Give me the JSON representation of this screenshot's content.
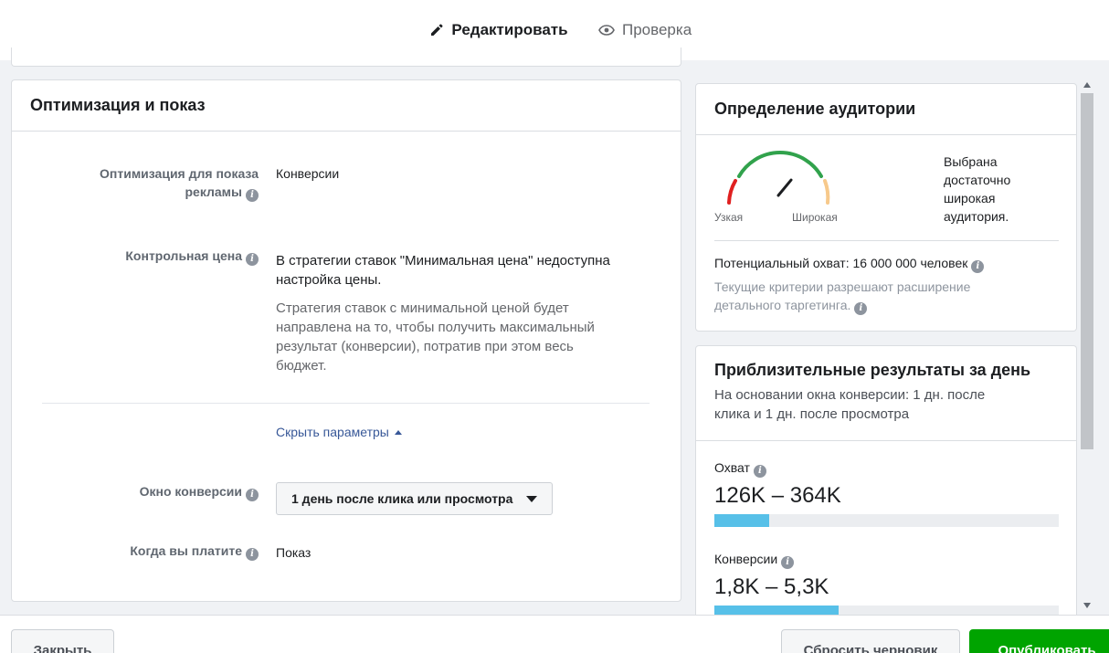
{
  "tabs": {
    "edit_label": "Редактировать",
    "review_label": "Проверка"
  },
  "optimization": {
    "title": "Оптимизация и показ",
    "ad_optimization_label_1": "Оптимизация для показа",
    "ad_optimization_label_2": "рекламы",
    "ad_optimization_value": "Конверсии",
    "control_price_label": "Контрольная цена",
    "control_price_line_1": "В стратегии ставок \"Минимальная цена\" недоступна",
    "control_price_line_2": "настройка цены.",
    "strategy_line_1": "Стратегия ставок с минимальной ценой будет",
    "strategy_line_2": "направлена на то, чтобы получить максимальный",
    "strategy_line_3": "результат (конверсии), потратив при этом весь",
    "strategy_line_4": "бюджет.",
    "hide_params_link": "Скрыть параметры",
    "conversion_window_label": "Окно конверсии",
    "conversion_window_value": "1 день после клика или просмотра",
    "when_you_pay_label": "Когда вы платите",
    "when_you_pay_value": "Показ"
  },
  "audience": {
    "title": "Определение аудитории",
    "gauge_narrow": "Узкая",
    "gauge_broad": "Широкая",
    "gauge_level": 0.72,
    "desc_1": "Выбрана",
    "desc_2": "достаточно",
    "desc_3": "широкая",
    "desc_4": "аудитория.",
    "potential_reach": "Потенциальный охват: 16 000 000 человек",
    "note_1": "Текущие критерии разрешают расширение",
    "note_2": "детального таргетинга."
  },
  "results": {
    "title": "Приблизительные результаты за день",
    "subtitle_1": "На основании окна конверсии: 1 дн. после",
    "subtitle_2": "клика и 1 дн. после просмотра",
    "reach_label": "Охват",
    "reach_value": "126K – 364K",
    "reach_fill": 0.16,
    "conversions_label": "Конверсии",
    "conversions_value": "1,8K – 5,3K",
    "conversions_fill": 0.36
  },
  "footer": {
    "close_label": "Закрыть",
    "reset_label": "Сбросить черновик",
    "publish_label": "Опубликовать"
  },
  "colors": {
    "accent": "#1877f2",
    "bar": "#57c0e8",
    "publish": "#00a400"
  }
}
